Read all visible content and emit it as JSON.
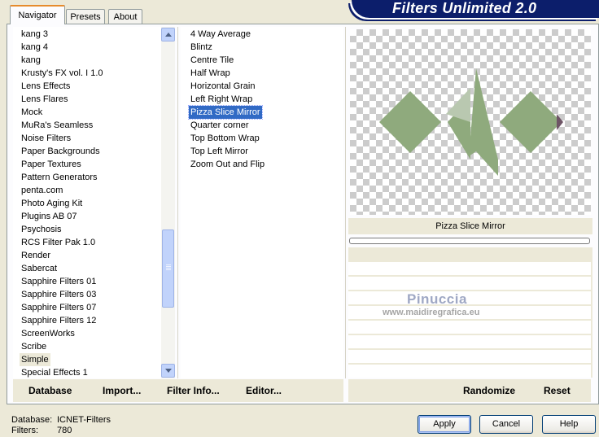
{
  "title": "Filters Unlimited 2.0",
  "tabs": [
    {
      "label": "Navigator",
      "active": true
    },
    {
      "label": "Presets",
      "active": false
    },
    {
      "label": "About",
      "active": false
    }
  ],
  "categories": [
    "kang 3",
    "kang 4",
    "kang",
    "Krusty's FX vol. I 1.0",
    "Lens Effects",
    "Lens Flares",
    "Mock",
    "MuRa's Seamless",
    "Noise Filters",
    "Paper Backgrounds",
    "Paper Textures",
    "Pattern Generators",
    "penta.com",
    "Photo Aging Kit",
    "Plugins AB 07",
    "Psychosis",
    "RCS Filter Pak 1.0",
    "Render",
    "Sabercat",
    "Sapphire Filters 01",
    "Sapphire Filters 03",
    "Sapphire Filters 07",
    "Sapphire Filters 12",
    "ScreenWorks",
    "Scribe",
    "Simple",
    "Special Effects 1"
  ],
  "selected_category": "Simple",
  "filters": [
    "4 Way Average",
    "Blintz",
    "Centre Tile",
    "Half Wrap",
    "Horizontal Grain",
    "Left Right Wrap",
    "Pizza Slice Mirror",
    "Quarter corner",
    "Top Bottom Wrap",
    "Top Left Mirror",
    "Zoom Out and Flip"
  ],
  "selected_filter": "Pizza Slice Mirror",
  "preview": {
    "filter_name": "Pizza Slice Mirror",
    "shape_color": "#8faa7d",
    "accent_color": "#6e5566"
  },
  "watermark": {
    "name": "Pinuccia",
    "url": "www.maidiregrafica.eu"
  },
  "toolbar": {
    "database": "Database",
    "import": "Import...",
    "filter_info": "Filter Info...",
    "editor": "Editor...",
    "randomize": "Randomize",
    "reset": "Reset"
  },
  "info": {
    "database_label": "Database:",
    "database_value": "ICNET-Filters",
    "filters_label": "Filters:",
    "filters_value": "780"
  },
  "buttons": {
    "apply": "Apply",
    "cancel": "Cancel",
    "help": "Help"
  }
}
